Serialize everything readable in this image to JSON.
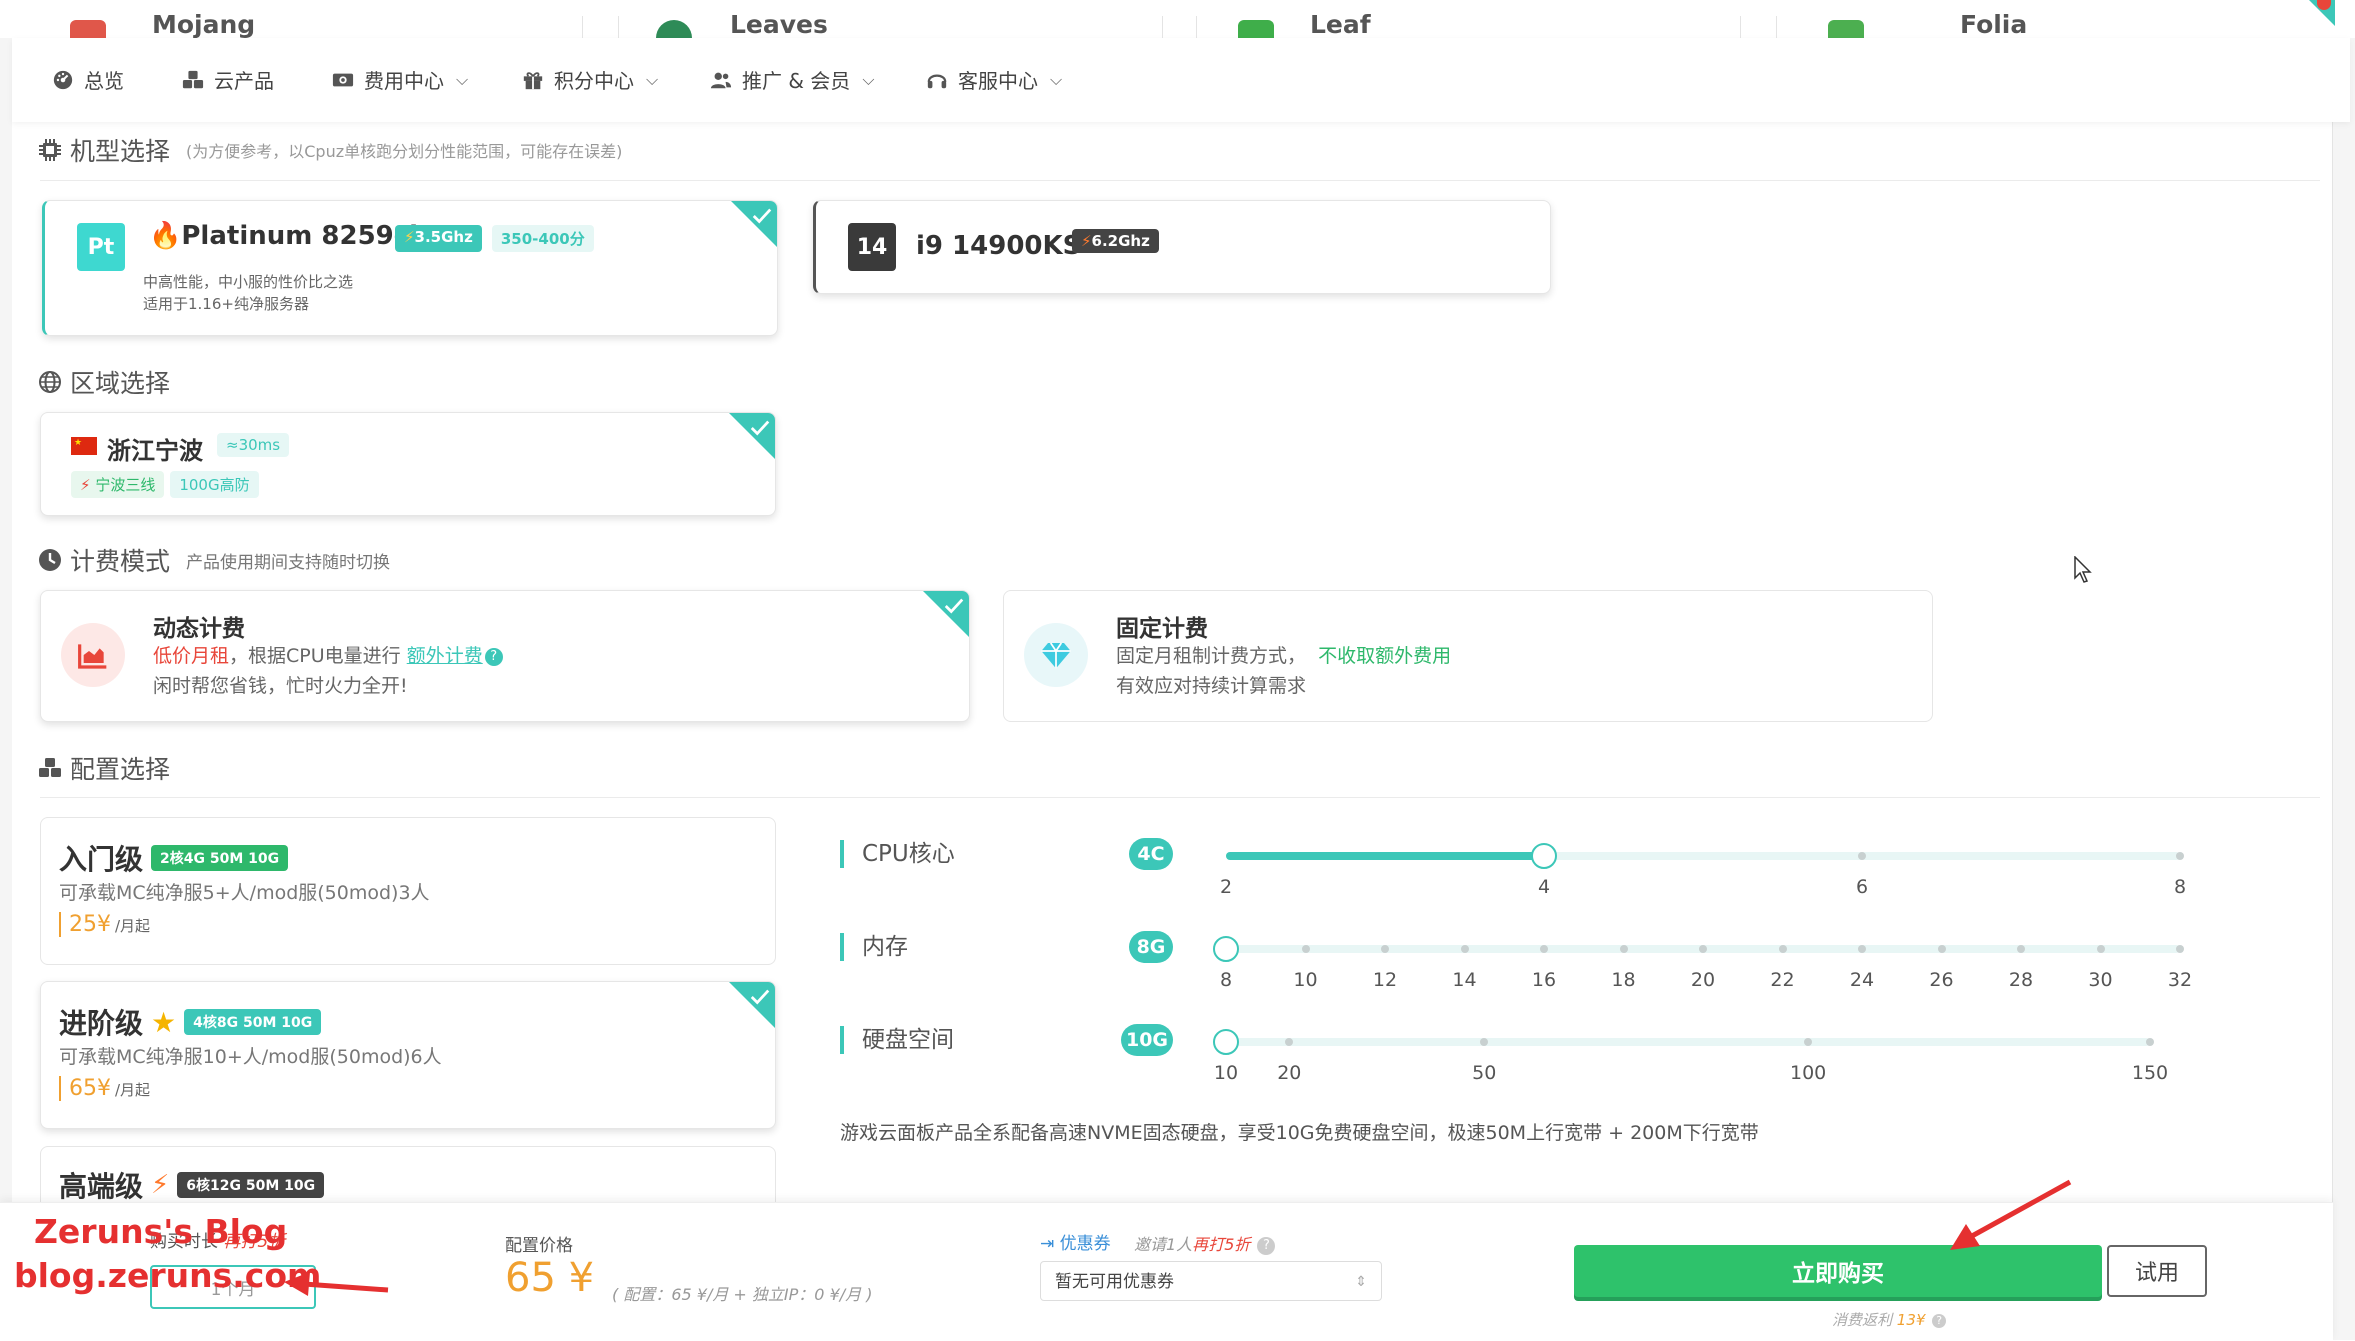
{
  "top_strip": {
    "tabs": [
      "Mojang",
      "Leaves",
      "Leaf",
      "Folia"
    ]
  },
  "nav": {
    "items": [
      {
        "label": "总览",
        "icon": "dashboard-icon",
        "dropdown": false
      },
      {
        "label": "云产品",
        "icon": "cubes-icon",
        "dropdown": false
      },
      {
        "label": "费用中心",
        "icon": "money-icon",
        "dropdown": true
      },
      {
        "label": "积分中心",
        "icon": "gift-icon",
        "dropdown": true
      },
      {
        "label": "推广 & 会员",
        "icon": "users-icon",
        "dropdown": true
      },
      {
        "label": "客服中心",
        "icon": "headset-icon",
        "dropdown": true
      }
    ]
  },
  "model_section": {
    "title": "机型选择",
    "hint": "(为方便参考，以Cpuz单核跑分划分性能范围，可能存在误差)",
    "cards": [
      {
        "logo": "Pt",
        "name": "Platinum 8259cl",
        "freq": "3.5Ghz",
        "score": "350-400分",
        "desc1": "中高性能，中小服的性价比之选",
        "desc2": "适用于1.16+纯净服务器",
        "selected": true
      },
      {
        "logo": "14",
        "name": "i9 14900KS",
        "freq": "6.2Ghz",
        "selected": false
      }
    ]
  },
  "region_section": {
    "title": "区域选择",
    "card": {
      "name": "浙江宁波",
      "latency": "≈30ms",
      "tag1": "宁波三线",
      "tag2": "100G高防",
      "selected": true
    }
  },
  "billing_section": {
    "title": "计费模式",
    "hint": "产品使用期间支持随时切换",
    "dynamic": {
      "title": "动态计费",
      "lead": "低价月租",
      "mid": "，根据CPU电量进行",
      "link": "额外计费",
      "line2": "闲时帮您省钱，忙时火力全开!",
      "selected": true
    },
    "fixed": {
      "title": "固定计费",
      "lead": "固定月租制计费方式，",
      "green": "不收取额外费用",
      "line2": "有效应对持续计算需求",
      "selected": false
    }
  },
  "config_section": {
    "title": "配置选择",
    "tiers": [
      {
        "title": "入门级",
        "spec": "2核4G 50M 10G",
        "desc": "可承载MC纯净服5+人/mod服(50mod)3人",
        "price": "25¥",
        "unit": "/月起",
        "selected": false
      },
      {
        "title": "进阶级",
        "spec": "4核8G 50M 10G",
        "desc": "可承载MC纯净服10+人/mod服(50mod)6人",
        "price": "65¥",
        "unit": "/月起",
        "selected": true
      },
      {
        "title": "高端级",
        "spec": "6核12G 50M 10G",
        "selected": false
      }
    ],
    "sliders": [
      {
        "label": "CPU核心",
        "value_label": "4C",
        "value": 4,
        "ticks": [
          "2",
          "4",
          "6",
          "8"
        ]
      },
      {
        "label": "内存",
        "value_label": "8G",
        "value": 8,
        "ticks": [
          "8",
          "10",
          "12",
          "14",
          "16",
          "18",
          "20",
          "22",
          "24",
          "26",
          "28",
          "30",
          "32"
        ]
      },
      {
        "label": "硬盘空间",
        "value_label": "10G",
        "value": 10,
        "ticks": [
          "10",
          "20",
          "50",
          "100",
          "150"
        ]
      }
    ],
    "note": "游戏云面板产品全系配备高速NVME固态硬盘，享受10G免费硬盘空间，极速50M上行宽带 + 200M下行宽带"
  },
  "bottom_bar": {
    "period_label": "购买时长",
    "period_discount": "再打5折",
    "period_value": "1个月",
    "price_label": "配置价格",
    "price": "65 ¥",
    "price_note": "( 配置：65 ¥/月 + 独立IP：0 ¥/月 )",
    "coupon_label": "优惠券",
    "coupon_hint_prefix": "邀请1人",
    "coupon_hint_red": "再打5折",
    "coupon_select": "暂无可用优惠券",
    "buy_label": "立即购买",
    "trial_label": "试用",
    "rebate_prefix": "消费返利",
    "rebate_value": "13¥"
  },
  "watermark": {
    "line1": "Zeruns's Blog",
    "line2": "blog.zeruns.com"
  },
  "colors": {
    "accent": "#3cc7b8",
    "buy": "#2ec26b",
    "price": "#f0a030",
    "danger": "#e8463a"
  }
}
